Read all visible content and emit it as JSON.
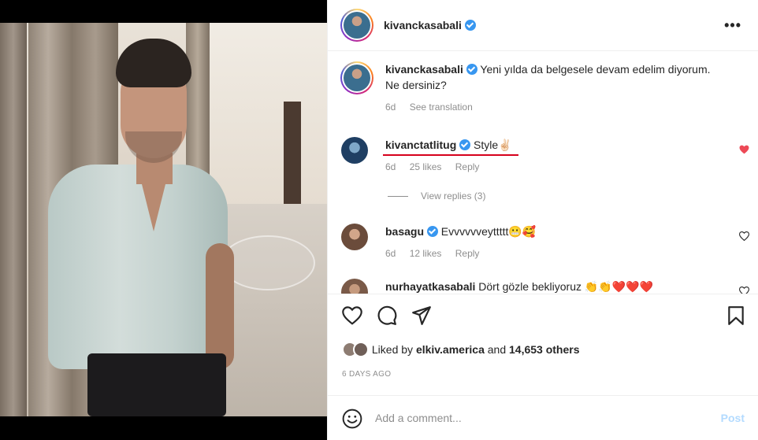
{
  "post": {
    "author": "kivanckasabali",
    "caption_text": "Yeni yılda da belgesele devam edelim diyorum. Ne dersiniz?",
    "caption_age": "6d",
    "see_translation": "See translation"
  },
  "comments": [
    {
      "username": "kivanctatlitug",
      "text": "Style✌🏻",
      "age": "6d",
      "likes": "25 likes",
      "reply": "Reply",
      "liked": true
    },
    {
      "username": "basagu",
      "text": "Evvvvvveyttttt😬🥰",
      "age": "6d",
      "likes": "12 likes",
      "reply": "Reply",
      "liked": false
    },
    {
      "username": "nurhayatkasabali",
      "text": "Dört gözle bekliyoruz 👏👏❤️❤️❤️",
      "age": "",
      "likes": "",
      "reply": "",
      "liked": false
    }
  ],
  "view_replies": "View replies (3)",
  "more_glyph": "•••",
  "likes": {
    "prefix": "Liked by ",
    "liker": "elkiv.america",
    "middle": " and ",
    "count": "14,653 others"
  },
  "date": "6 DAYS AGO",
  "add_comment": {
    "placeholder": "Add a comment...",
    "post_label": "Post"
  },
  "colors": {
    "verified": "#3897f0",
    "liked_heart": "#ed4956",
    "underline": "#d6001c",
    "post_disabled": "#b3dbff"
  }
}
